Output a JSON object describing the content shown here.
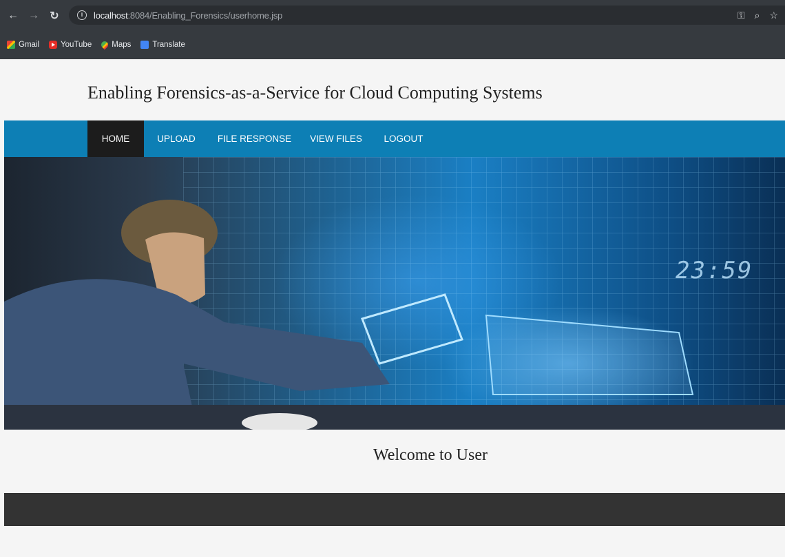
{
  "browser": {
    "url_host": "localhost",
    "url_rest": ":8084/Enabling_Forensics/userhome.jsp",
    "bookmarks": [
      "Gmail",
      "YouTube",
      "Maps",
      "Translate"
    ]
  },
  "site": {
    "title": "Enabling Forensics-as-a-Service for Cloud Computing Systems",
    "nav": [
      "HOME",
      "UPLOAD",
      "FILE RESPONSE",
      "VIEW FILES",
      "LOGOUT"
    ],
    "active_nav": "HOME",
    "hero_clock": "23:59",
    "welcome": "Welcome to User"
  },
  "colors": {
    "navbar": "#0d7fb5",
    "active_nav": "#1c1c1c",
    "footer": "#333333"
  }
}
